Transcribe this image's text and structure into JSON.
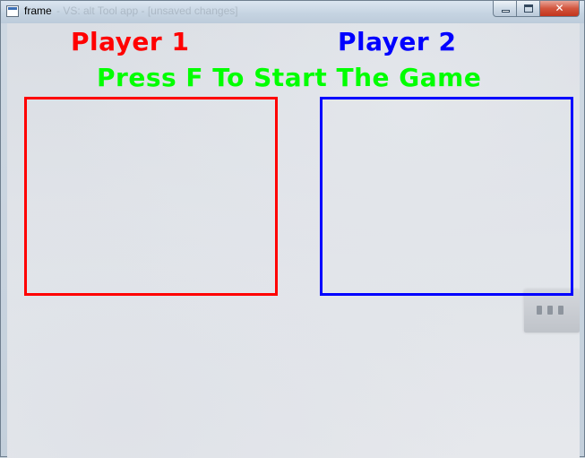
{
  "window": {
    "title": "frame",
    "ghost_title": "- VS: alt Tool app - [unsaved changes]",
    "minimize_label": "",
    "maximize_label": "",
    "close_label": "✕"
  },
  "game": {
    "player1_label": "Player 1",
    "player2_label": "Player 2",
    "start_message": "Press F To Start The Game"
  },
  "colors": {
    "player1": "#ff0000",
    "player2": "#0000ff",
    "message": "#00ff00"
  }
}
